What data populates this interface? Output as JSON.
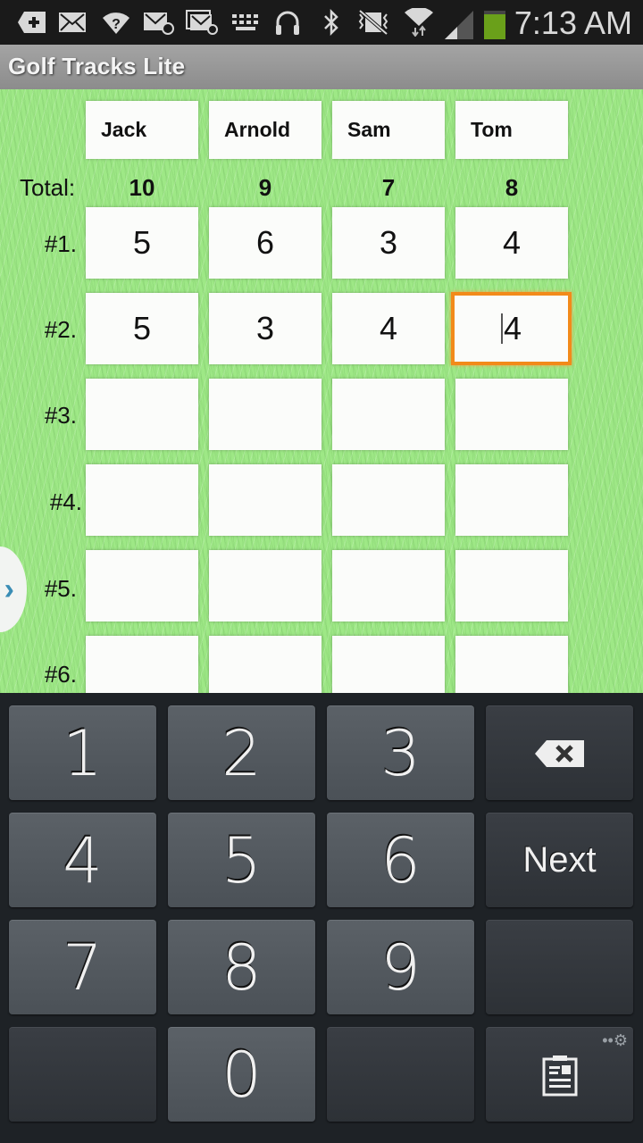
{
  "status_bar": {
    "time": "7:13 AM",
    "icons": [
      "add-notification-icon",
      "email-icon",
      "wifi-question-icon",
      "email-at-icon",
      "email-at-multiple-icon",
      "keyboard-icon",
      "headphones-icon",
      "bluetooth-icon",
      "vibrate-mute-icon",
      "wifi-icon",
      "signal-icon",
      "battery-icon"
    ],
    "battery_color": "#6aa01a"
  },
  "app": {
    "title": "Golf Tracks Lite"
  },
  "scorecard": {
    "total_label": "Total:",
    "players": [
      {
        "name": "Jack",
        "total": "10"
      },
      {
        "name": "Arnold",
        "total": "9"
      },
      {
        "name": "Sam",
        "total": "7"
      },
      {
        "name": "Tom",
        "total": "8"
      }
    ],
    "holes": [
      {
        "label": "#1.",
        "scores": [
          "5",
          "6",
          "3",
          "4"
        ]
      },
      {
        "label": "#2.",
        "scores": [
          "5",
          "3",
          "4",
          "4"
        ]
      },
      {
        "label": "#3.",
        "scores": [
          "",
          "",
          "",
          ""
        ]
      },
      {
        "label": "#4.",
        "scores": [
          "",
          "",
          "",
          ""
        ]
      },
      {
        "label": "#5.",
        "scores": [
          "",
          "",
          "",
          ""
        ]
      },
      {
        "label": "#6.",
        "scores": [
          "",
          "",
          "",
          ""
        ]
      }
    ],
    "focused_cell": {
      "hole": "#2.",
      "player": "Tom"
    },
    "focus_color": "#f28a1a"
  },
  "side_tab": {
    "icon": "chevron-right-icon"
  },
  "keyboard": {
    "rows": [
      [
        "1",
        "2",
        "3",
        "backspace"
      ],
      [
        "4",
        "5",
        "6",
        "Next"
      ],
      [
        "7",
        "8",
        "9",
        ""
      ],
      [
        "",
        "0",
        "",
        "clipboard"
      ]
    ],
    "next_label": "Next",
    "settings_icon": "gear-icon"
  }
}
